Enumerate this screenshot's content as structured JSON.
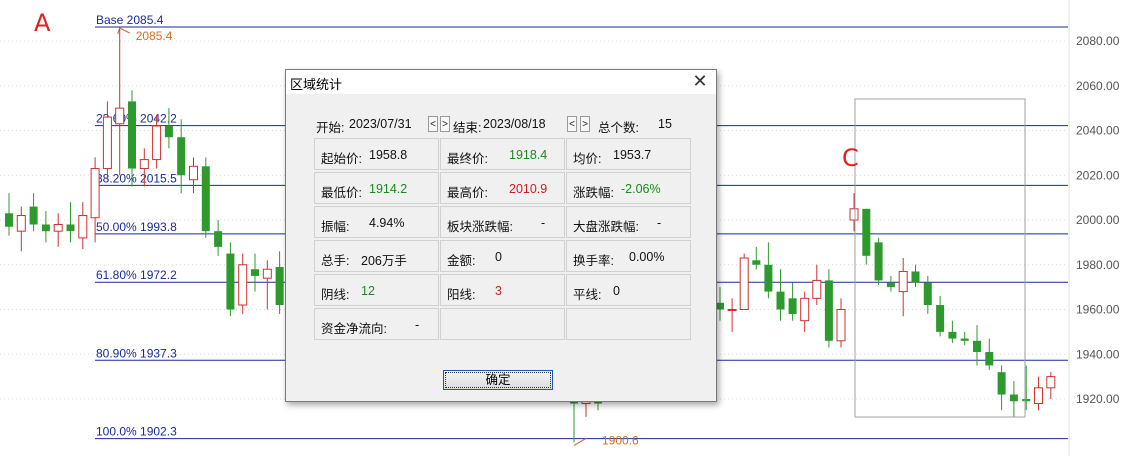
{
  "chart_data": {
    "type": "candlestick",
    "y_ticks": [
      "2080.00",
      "2060.00",
      "2040.00",
      "2020.00",
      "2000.00",
      "1980.00",
      "1960.00",
      "1940.00",
      "1920.00"
    ],
    "ylim": [
      1899,
      2087
    ],
    "fib_levels": [
      {
        "label": "Base   2085.4",
        "value": 2085.4
      },
      {
        "label": "23.60% 2042.2",
        "value": 2042.2
      },
      {
        "label": "38.20% 2015.5",
        "value": 2015.5
      },
      {
        "label": "50.00% 1993.8",
        "value": 1993.8
      },
      {
        "label": "61.80% 1972.2",
        "value": 1972.2
      },
      {
        "label": "80.90% 1937.3",
        "value": 1937.3
      },
      {
        "label": "100.0% 1902.3",
        "value": 1902.3
      }
    ],
    "high_marker": "2085.4",
    "low_marker": "1900.6",
    "annotations": [
      "A",
      "C"
    ],
    "up_color": "#d03030",
    "down_color": "#2e9a2e",
    "fib_color": "#1a2a9a",
    "candles": [
      {
        "o": 2003,
        "h": 2012,
        "l": 1993,
        "c": 1997
      },
      {
        "o": 1995,
        "h": 2006,
        "l": 1986,
        "c": 2002
      },
      {
        "o": 2006,
        "h": 2012,
        "l": 1995,
        "c": 1998
      },
      {
        "o": 1998,
        "h": 2004,
        "l": 1990,
        "c": 1995
      },
      {
        "o": 1995,
        "h": 2003,
        "l": 1988,
        "c": 1998
      },
      {
        "o": 1998,
        "h": 2008,
        "l": 1990,
        "c": 1995
      },
      {
        "o": 1992,
        "h": 2008,
        "l": 1987,
        "c": 2002
      },
      {
        "o": 2001,
        "h": 2028,
        "l": 1990,
        "c": 2023
      },
      {
        "o": 2023,
        "h": 2053,
        "l": 2018,
        "c": 2046
      },
      {
        "o": 2043,
        "h": 2085.4,
        "l": 2020,
        "c": 2050
      },
      {
        "o": 2053,
        "h": 2058,
        "l": 2015,
        "c": 2023
      },
      {
        "o": 2023,
        "h": 2032,
        "l": 2015,
        "c": 2027
      },
      {
        "o": 2027,
        "h": 2047,
        "l": 2023,
        "c": 2042
      },
      {
        "o": 2042,
        "h": 2050,
        "l": 2032,
        "c": 2037
      },
      {
        "o": 2037,
        "h": 2045,
        "l": 2012,
        "c": 2020
      },
      {
        "o": 2018,
        "h": 2028,
        "l": 2012,
        "c": 2024
      },
      {
        "o": 2024,
        "h": 2028,
        "l": 1992,
        "c": 1995
      },
      {
        "o": 1995,
        "h": 2000,
        "l": 1984,
        "c": 1988
      },
      {
        "o": 1985,
        "h": 1990,
        "l": 1957,
        "c": 1960
      },
      {
        "o": 1962,
        "h": 1985,
        "l": 1958,
        "c": 1980
      },
      {
        "o": 1978,
        "h": 1985,
        "l": 1968,
        "c": 1975
      },
      {
        "o": 1974,
        "h": 1982,
        "l": 1960,
        "c": 1978
      },
      {
        "o": 1979,
        "h": 1986,
        "l": 1958,
        "c": 1962
      },
      {
        "o": 1960,
        "h": 1970,
        "l": 1935,
        "c": 1940
      },
      {
        "o": 1919,
        "h": 1926,
        "l": 1900.6,
        "c": 1918
      },
      {
        "o": 1918,
        "h": 1930,
        "l": 1912,
        "c": 1925
      },
      {
        "o": 1922,
        "h": 1930,
        "l": 1915,
        "c": 1918
      },
      {
        "o": 1963,
        "h": 1970,
        "l": 1955,
        "c": 1960
      },
      {
        "o": 1960,
        "h": 1965,
        "l": 1950,
        "c": 1960
      },
      {
        "o": 1960,
        "h": 1985,
        "l": 1960,
        "c": 1983
      },
      {
        "o": 1982,
        "h": 1988,
        "l": 1978,
        "c": 1980
      },
      {
        "o": 1980,
        "h": 1990,
        "l": 1965,
        "c": 1968
      },
      {
        "o": 1968,
        "h": 1978,
        "l": 1955,
        "c": 1960
      },
      {
        "o": 1965,
        "h": 1972,
        "l": 1955,
        "c": 1958
      },
      {
        "o": 1955,
        "h": 1968,
        "l": 1950,
        "c": 1965
      },
      {
        "o": 1965,
        "h": 1980,
        "l": 1962,
        "c": 1973
      },
      {
        "o": 1973,
        "h": 1978,
        "l": 1943,
        "c": 1946
      },
      {
        "o": 1946,
        "h": 1965,
        "l": 1943,
        "c": 1960
      },
      {
        "o": 2000,
        "h": 2012,
        "l": 1995,
        "c": 2005
      },
      {
        "o": 2005,
        "h": 2005,
        "l": 1980,
        "c": 1984
      },
      {
        "o": 1990,
        "h": 1992,
        "l": 1971,
        "c": 1973
      },
      {
        "o": 1972,
        "h": 1975,
        "l": 1968,
        "c": 1970
      },
      {
        "o": 1968,
        "h": 1983,
        "l": 1957,
        "c": 1977
      },
      {
        "o": 1977,
        "h": 1980,
        "l": 1970,
        "c": 1972
      },
      {
        "o": 1972,
        "h": 1975,
        "l": 1958,
        "c": 1962
      },
      {
        "o": 1962,
        "h": 1966,
        "l": 1948,
        "c": 1950
      },
      {
        "o": 1950,
        "h": 1955,
        "l": 1945,
        "c": 1947
      },
      {
        "o": 1947,
        "h": 1950,
        "l": 1944,
        "c": 1946
      },
      {
        "o": 1946,
        "h": 1953,
        "l": 1935,
        "c": 1941
      },
      {
        "o": 1941,
        "h": 1947,
        "l": 1933,
        "c": 1935
      },
      {
        "o": 1932,
        "h": 1935,
        "l": 1915,
        "c": 1922
      },
      {
        "o": 1922,
        "h": 1928,
        "l": 1912,
        "c": 1919
      },
      {
        "o": 1920,
        "h": 1935,
        "l": 1915,
        "c": 1919
      },
      {
        "o": 1918,
        "h": 1930,
        "l": 1915,
        "c": 1925
      },
      {
        "o": 1925,
        "h": 1932,
        "l": 1920,
        "c": 1930
      }
    ]
  },
  "dialog": {
    "title": "区域统计",
    "close_icon": "close-icon",
    "start_label": "开始:",
    "start_date": "2023/07/31",
    "end_label": "结束:",
    "end_date": "2023/08/18",
    "prev_symbol": "<",
    "next_symbol": ">",
    "count_label": "总个数:",
    "count_value": "15",
    "stats": [
      {
        "label": "起始价:",
        "value": "1958.8",
        "color": ""
      },
      {
        "label": "最终价:",
        "value": "1918.4",
        "color": "green"
      },
      {
        "label": "均价:",
        "value": "1953.7",
        "color": ""
      },
      {
        "label": "最低价:",
        "value": "1914.2",
        "color": "green"
      },
      {
        "label": "最高价:",
        "value": "2010.9",
        "color": "red"
      },
      {
        "label": "涨跌幅:",
        "value": "-2.06%",
        "color": "green"
      },
      {
        "label": "振幅:",
        "value": "4.94%",
        "color": ""
      },
      {
        "label": "板块涨跌幅:",
        "value": "-",
        "color": ""
      },
      {
        "label": "大盘涨跌幅:",
        "value": "-",
        "color": ""
      },
      {
        "label": "总手:",
        "value": "206万手",
        "color": ""
      },
      {
        "label": "金额:",
        "value": "0",
        "color": ""
      },
      {
        "label": "换手率:",
        "value": "0.00%",
        "color": ""
      },
      {
        "label": "阴线:",
        "value": "12",
        "color": "green"
      },
      {
        "label": "阳线:",
        "value": "3",
        "color": "red"
      },
      {
        "label": "平线:",
        "value": "0",
        "color": ""
      },
      {
        "label": "资金净流向:",
        "value": "-",
        "color": ""
      },
      {
        "label": "",
        "value": "",
        "color": ""
      },
      {
        "label": "",
        "value": "",
        "color": ""
      }
    ],
    "ok_label": "确定"
  }
}
